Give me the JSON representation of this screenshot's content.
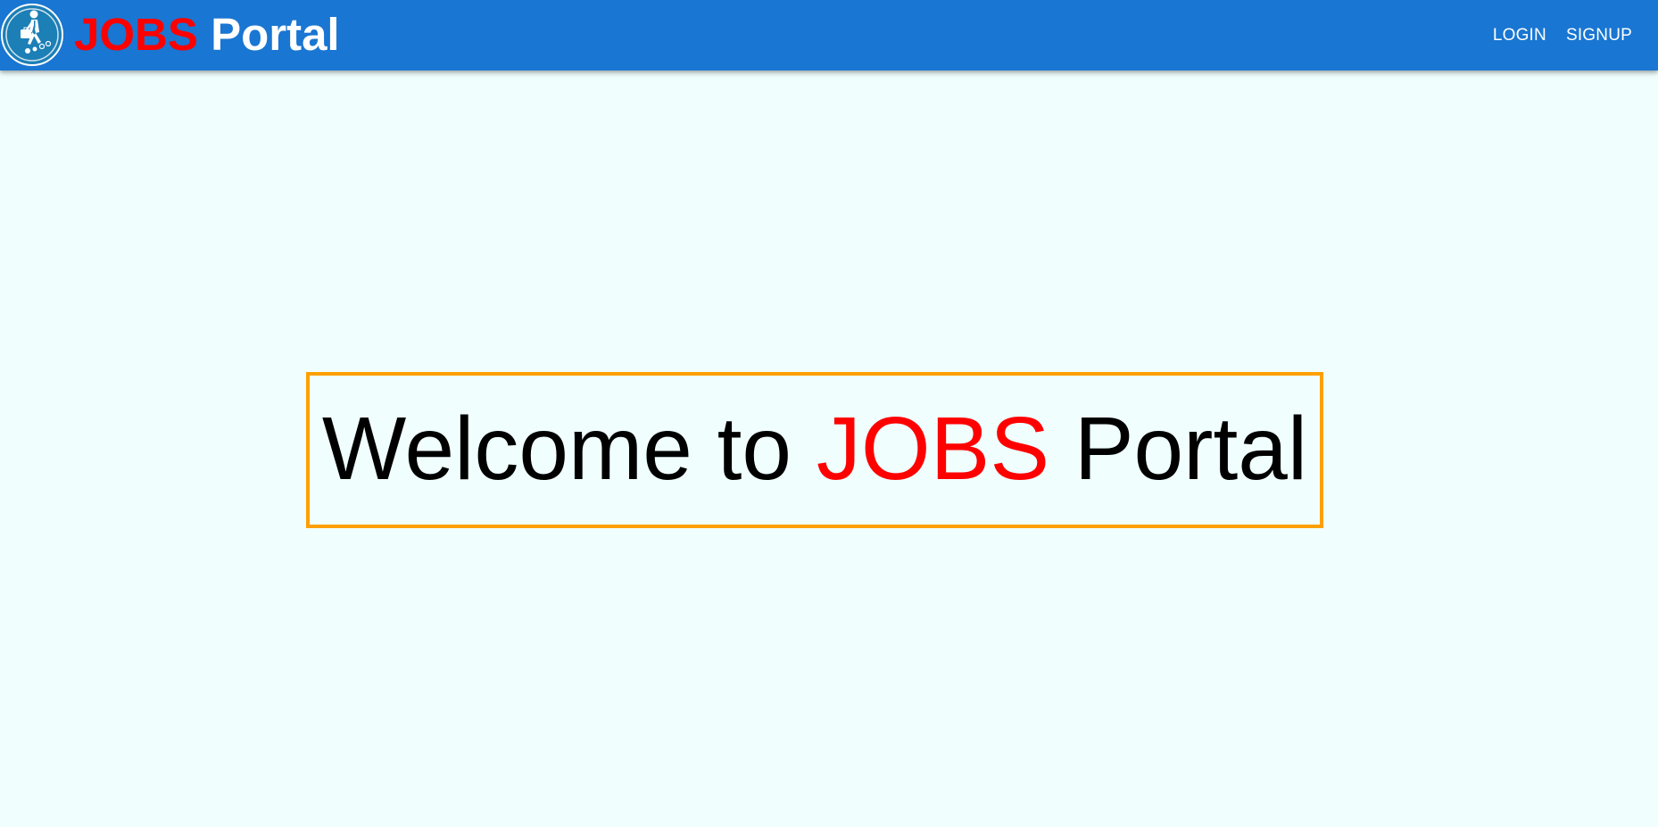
{
  "header": {
    "logo_icon": "job-seeker-logo-icon",
    "brand_accent": "JOBS",
    "brand_rest": "Portal",
    "nav": {
      "login_label": "LOGIN",
      "signup_label": "SIGNUP"
    }
  },
  "main": {
    "welcome_prefix": "Welcome to",
    "welcome_accent": "JOBS",
    "welcome_suffix": "Portal"
  },
  "colors": {
    "appbar": "#1976d2",
    "accent_red": "#ff0000",
    "box_border": "#ffa000",
    "page_background": "#f0fffe"
  }
}
